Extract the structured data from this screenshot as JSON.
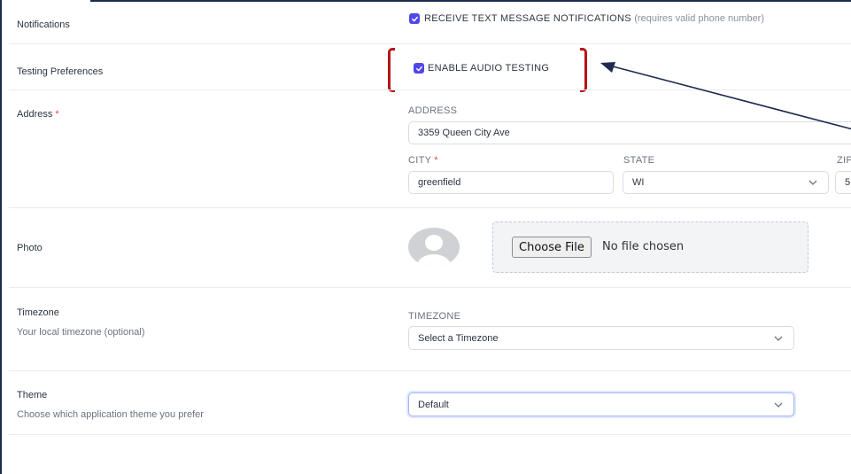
{
  "rows": {
    "notifications": {
      "label": "Notifications",
      "option_label": "RECEIVE TEXT MESSAGE NOTIFICATIONS",
      "option_hint": "(requires valid phone number)",
      "checked": true
    },
    "testing": {
      "label": "Testing Preferences",
      "option_label": "ENABLE AUDIO TESTING",
      "checked": true
    },
    "address": {
      "label": "Address",
      "required_mark": "*",
      "address_caption": "ADDRESS",
      "address_value": "3359 Queen City Ave",
      "city_caption": "CITY",
      "city_required_mark": "*",
      "city_value": "greenfield",
      "state_caption": "STATE",
      "state_value": "WI",
      "zip_caption": "ZIP",
      "zip_value": "5"
    },
    "photo": {
      "label": "Photo",
      "choose_button": "Choose File",
      "no_file": "No file chosen"
    },
    "timezone": {
      "label": "Timezone",
      "description": "Your local timezone (optional)",
      "caption": "TIMEZONE",
      "placeholder": "Select a Timezone"
    },
    "theme": {
      "label": "Theme",
      "description": "Choose which application theme you prefer",
      "value": "Default"
    }
  },
  "colors": {
    "accent": "#5147e8",
    "highlight_bracket": "#b51616",
    "annotation_arrow": "#1d2b4f",
    "required": "#ef4444"
  },
  "icons": {
    "checkbox": "check-icon",
    "select": "chevron-down-icon",
    "avatar": "user-placeholder-icon"
  }
}
